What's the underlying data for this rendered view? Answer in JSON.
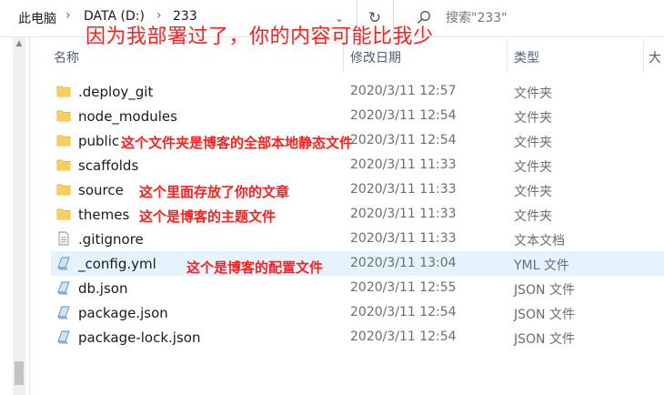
{
  "address_bar": {
    "crumbs": [
      "此电脑",
      "DATA (D:)",
      "233"
    ],
    "separator": "›",
    "history_glyph": "⌄",
    "refresh_glyph": "↻"
  },
  "search": {
    "placeholder": "搜索\"233\"",
    "icon": "search-icon"
  },
  "headline": "因为我部署过了，你的内容可能比我少",
  "columns": {
    "name": "名称",
    "date": "修改日期",
    "type": "类型",
    "size": "大"
  },
  "files": [
    {
      "name": ".deploy_git",
      "date": "2020/3/11 12:57",
      "type": "文件夹",
      "icon": "folder-icon"
    },
    {
      "name": "node_modules",
      "date": "2020/3/11 12:54",
      "type": "文件夹",
      "icon": "folder-icon"
    },
    {
      "name": "public",
      "date": "2020/3/11 12:54",
      "type": "文件夹",
      "icon": "folder-icon"
    },
    {
      "name": "scaffolds",
      "date": "2020/3/11 11:33",
      "type": "文件夹",
      "icon": "folder-icon"
    },
    {
      "name": "source",
      "date": "2020/3/11 11:33",
      "type": "文件夹",
      "icon": "folder-icon"
    },
    {
      "name": "themes",
      "date": "2020/3/11 11:33",
      "type": "文件夹",
      "icon": "folder-icon"
    },
    {
      "name": ".gitignore",
      "date": "2020/3/11 11:33",
      "type": "文本文档",
      "icon": "text-file-icon"
    },
    {
      "name": "_config.yml",
      "date": "2020/3/11 13:04",
      "type": "YML 文件",
      "icon": "script-file-icon",
      "selected": true
    },
    {
      "name": "db.json",
      "date": "2020/3/11 12:55",
      "type": "JSON 文件",
      "icon": "script-file-icon"
    },
    {
      "name": "package.json",
      "date": "2020/3/11 12:54",
      "type": "JSON 文件",
      "icon": "script-file-icon"
    },
    {
      "name": "package-lock.json",
      "date": "2020/3/11 12:54",
      "type": "JSON 文件",
      "icon": "script-file-icon"
    }
  ],
  "annotations": {
    "public": "这个文件夹是博客的全部本地静态文件",
    "source": "这个里面存放了你的文章",
    "themes": "这个是博客的主题文件",
    "config": "这个是博客的配置文件"
  },
  "colors": {
    "annotation_red": "#ff1f1f",
    "selected_row": "#e5f3ff",
    "folder_yellow": "#f8d775",
    "header_text": "#4c607a"
  }
}
